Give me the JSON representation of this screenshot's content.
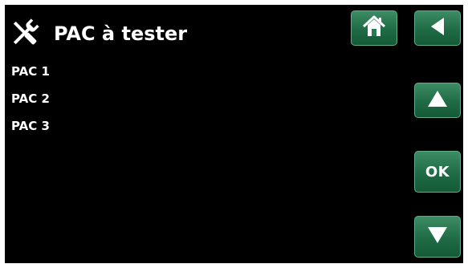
{
  "header": {
    "title": "PAC à tester",
    "title_icon": "tools-icon"
  },
  "nav": {
    "home_icon": "home-icon",
    "back_icon": "back-arrow-icon",
    "up_icon": "up-arrow-icon",
    "ok_label": "OK",
    "down_icon": "down-arrow-icon"
  },
  "list": {
    "items": [
      {
        "label": "PAC 1"
      },
      {
        "label": "PAC 2"
      },
      {
        "label": "PAC 3"
      }
    ]
  },
  "colors": {
    "background": "#000000",
    "button": "#1f6b45",
    "button_border": "#5fae87",
    "text": "#ffffff"
  }
}
